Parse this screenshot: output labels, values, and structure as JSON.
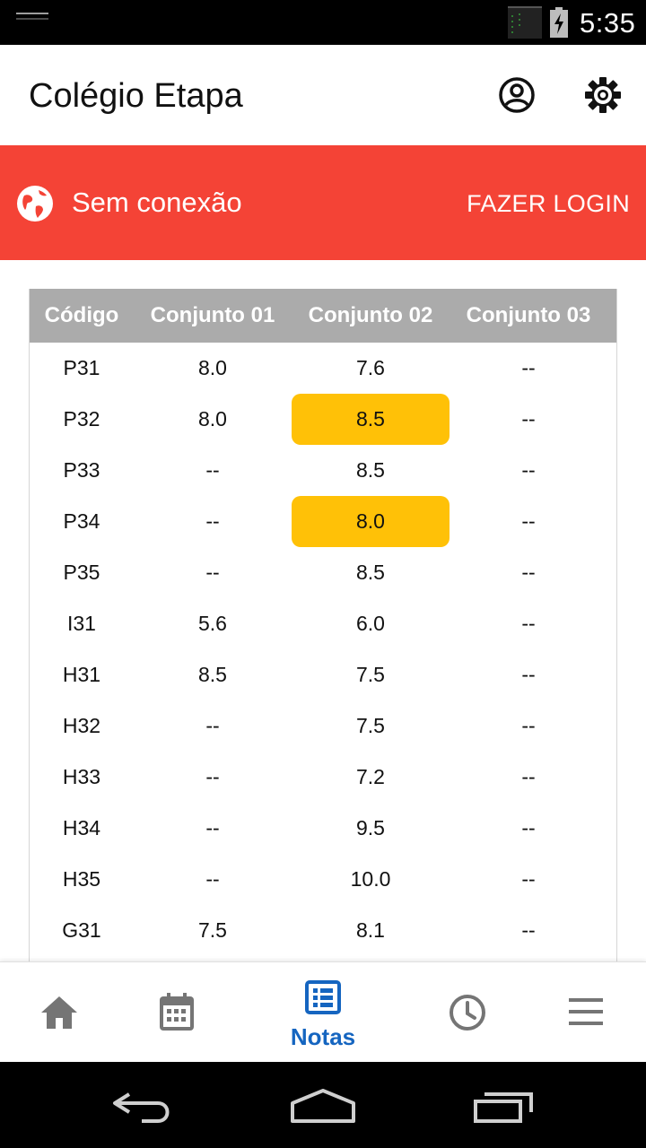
{
  "status_bar": {
    "time": "5:35",
    "icons": [
      "notification-icon",
      "signal-icon",
      "battery-charging-icon"
    ]
  },
  "app_bar": {
    "title": "Colégio Etapa",
    "icons": [
      "account-icon",
      "settings-icon"
    ]
  },
  "banner": {
    "message": "Sem conexão",
    "action": "FAZER LOGIN",
    "color": "#f44336",
    "icon": "globe-icon"
  },
  "grades": {
    "headers": [
      "Código",
      "Conjunto 01",
      "Conjunto 02",
      "Conjunto 03"
    ],
    "highlight_color": "#ffc107",
    "rows": [
      {
        "code": "P31",
        "c1": "8.0",
        "c2": "7.6",
        "c3": "--",
        "highlight": false
      },
      {
        "code": "P32",
        "c1": "8.0",
        "c2": "8.5",
        "c3": "--",
        "highlight": true
      },
      {
        "code": "P33",
        "c1": "--",
        "c2": "8.5",
        "c3": "--",
        "highlight": false
      },
      {
        "code": "P34",
        "c1": "--",
        "c2": "8.0",
        "c3": "--",
        "highlight": true
      },
      {
        "code": "P35",
        "c1": "--",
        "c2": "8.5",
        "c3": "--",
        "highlight": false
      },
      {
        "code": "I31",
        "c1": "5.6",
        "c2": "6.0",
        "c3": "--",
        "highlight": false
      },
      {
        "code": "H31",
        "c1": "8.5",
        "c2": "7.5",
        "c3": "--",
        "highlight": false
      },
      {
        "code": "H32",
        "c1": "--",
        "c2": "7.5",
        "c3": "--",
        "highlight": false
      },
      {
        "code": "H33",
        "c1": "--",
        "c2": "7.2",
        "c3": "--",
        "highlight": false
      },
      {
        "code": "H34",
        "c1": "--",
        "c2": "9.5",
        "c3": "--",
        "highlight": false
      },
      {
        "code": "H35",
        "c1": "--",
        "c2": "10.0",
        "c3": "--",
        "highlight": false
      },
      {
        "code": "G31",
        "c1": "7.5",
        "c2": "8.1",
        "c3": "--",
        "highlight": false
      }
    ]
  },
  "bottom_nav": {
    "items": [
      {
        "name": "home-icon",
        "label": "",
        "active": false
      },
      {
        "name": "calendar-icon",
        "label": "",
        "active": false
      },
      {
        "name": "notes-list-icon",
        "label": "Notas",
        "active": true
      },
      {
        "name": "clock-icon",
        "label": "",
        "active": false
      },
      {
        "name": "menu-icon",
        "label": "",
        "active": false
      }
    ],
    "active_color": "#1565c0",
    "inactive_color": "#757575"
  },
  "system_nav": {
    "icons": [
      "back-icon",
      "home-outline-icon",
      "recent-apps-icon"
    ]
  }
}
